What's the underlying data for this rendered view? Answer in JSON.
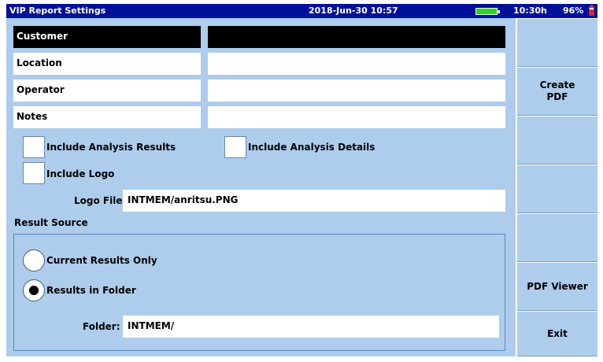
{
  "titlebar": {
    "title": "VIP Report Settings",
    "datetime": "2018-Jun-30 10:57",
    "battery_time": "10:30h",
    "battery_percent": "96%"
  },
  "fields": [
    {
      "label": "Customer",
      "value": "",
      "selected": true
    },
    {
      "label": "Location",
      "value": ""
    },
    {
      "label": "Operator",
      "value": ""
    },
    {
      "label": "Notes",
      "value": ""
    }
  ],
  "options": {
    "include_analysis_results": {
      "label": "Include Analysis Results",
      "checked": false
    },
    "include_analysis_details": {
      "label": "Include Analysis Details",
      "checked": false
    },
    "include_logo": {
      "label": "Include Logo",
      "checked": false
    }
  },
  "logo_file": {
    "label": "Logo File",
    "value": "INTMEM/anritsu.PNG"
  },
  "result_source": {
    "heading": "Result Source",
    "current_results_label": "Current Results Only",
    "results_in_folder_label": "Results in Folder",
    "selected": "results_in_folder",
    "folder_label": "Folder:",
    "folder_value": "INTMEM/"
  },
  "softkeys": {
    "create_pdf": "Create PDF",
    "pdf_viewer": "PDF Viewer",
    "exit": "Exit"
  },
  "colors": {
    "titlebar": "#00109b",
    "panel": "#aeccec",
    "selected_field": "#000000"
  }
}
